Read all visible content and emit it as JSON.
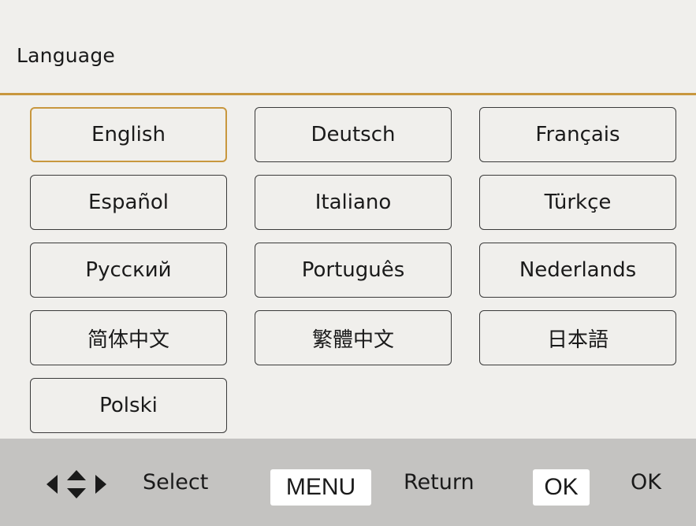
{
  "header": {
    "title": "Language"
  },
  "languages": [
    {
      "label": "English",
      "selected": true
    },
    {
      "label": "Deutsch",
      "selected": false
    },
    {
      "label": "Français",
      "selected": false
    },
    {
      "label": "Español",
      "selected": false
    },
    {
      "label": "Italiano",
      "selected": false
    },
    {
      "label": "Türkçe",
      "selected": false
    },
    {
      "label": "Русский",
      "selected": false
    },
    {
      "label": "Português",
      "selected": false
    },
    {
      "label": "Nederlands",
      "selected": false
    },
    {
      "label": "简体中文",
      "selected": false
    },
    {
      "label": "繁體中文",
      "selected": false
    },
    {
      "label": "日本語",
      "selected": false
    },
    {
      "label": "Polski",
      "selected": false
    }
  ],
  "footer": {
    "nav_icon": "four-way-arrow-icon",
    "select_label": "Select",
    "menu_key": "MENU",
    "return_label": "Return",
    "ok_key": "OK",
    "ok_label": "OK"
  },
  "colors": {
    "accent": "#c8973e",
    "background": "#f0efec",
    "footer": "#c4c3c1"
  }
}
